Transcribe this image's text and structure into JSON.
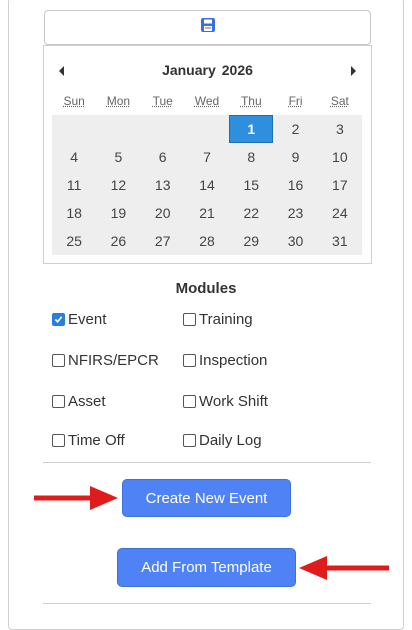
{
  "calendar": {
    "month": "January",
    "year": "2026",
    "weekdays": [
      "Sun",
      "Mon",
      "Tue",
      "Wed",
      "Thu",
      "Fri",
      "Sat"
    ],
    "selected_day": "1",
    "rows": [
      [
        "",
        "",
        "",
        "",
        "1",
        "2",
        "3"
      ],
      [
        "4",
        "5",
        "6",
        "7",
        "8",
        "9",
        "10"
      ],
      [
        "11",
        "12",
        "13",
        "14",
        "15",
        "16",
        "17"
      ],
      [
        "18",
        "19",
        "20",
        "21",
        "22",
        "23",
        "24"
      ],
      [
        "25",
        "26",
        "27",
        "28",
        "29",
        "30",
        "31"
      ]
    ]
  },
  "modules": {
    "title": "Modules",
    "items": [
      {
        "label": "Event",
        "checked": true
      },
      {
        "label": "Training",
        "checked": false
      },
      {
        "label": "NFIRS/EPCR",
        "checked": false
      },
      {
        "label": "Inspection",
        "checked": false
      },
      {
        "label": "Asset",
        "checked": false
      },
      {
        "label": "Work Shift",
        "checked": false
      },
      {
        "label": "Time Off",
        "checked": false
      },
      {
        "label": "Daily Log",
        "checked": false
      }
    ]
  },
  "actions": {
    "create_label": "Create New Event",
    "template_label": "Add From Template"
  },
  "colors": {
    "accent": "#4f83f5",
    "selected_day": "#2d8fde",
    "arrow": "#e01b1b"
  },
  "icons": {
    "top_button": "save-icon",
    "prev": "chevron-left-icon",
    "next": "chevron-right-icon"
  }
}
